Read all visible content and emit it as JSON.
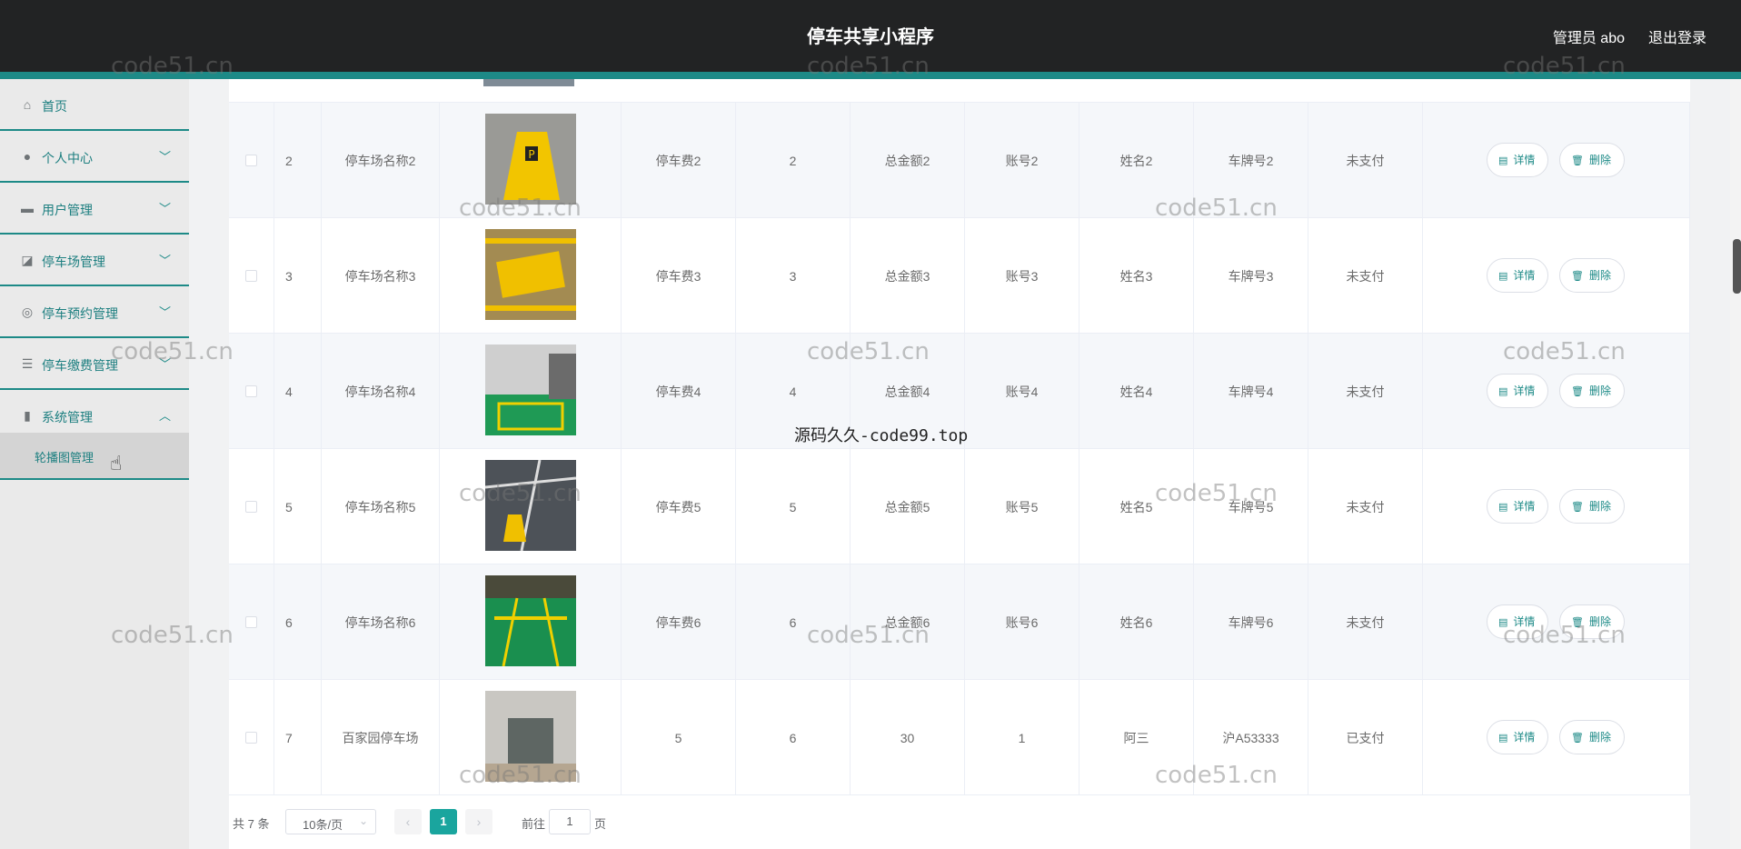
{
  "header": {
    "title": "停车共享小程序",
    "user": "管理员 abo",
    "logout": "退出登录"
  },
  "sidebar": {
    "items": [
      {
        "label": "首页",
        "icon": "home-icon"
      },
      {
        "label": "个人中心",
        "icon": "user-icon",
        "expandable": true
      },
      {
        "label": "用户管理",
        "icon": "users-icon",
        "expandable": true
      },
      {
        "label": "停车场管理",
        "icon": "chart-icon",
        "expandable": true
      },
      {
        "label": "停车预约管理",
        "icon": "lifebuoy-icon",
        "expandable": true
      },
      {
        "label": "停车缴费管理",
        "icon": "list-icon",
        "expandable": true
      },
      {
        "label": "系统管理",
        "icon": "bar-chart-icon",
        "expandable": true,
        "expanded": true
      }
    ],
    "submenu": {
      "label": "轮播图管理"
    }
  },
  "table": {
    "rows": [
      {
        "idx": "2",
        "name": "停车场名称2",
        "fee": "停车费2",
        "hours": "2",
        "total": "总金额2",
        "account": "账号2",
        "person": "姓名2",
        "plate": "车牌号2",
        "status": "未支付",
        "image": "warning-sign"
      },
      {
        "idx": "3",
        "name": "停车场名称3",
        "fee": "停车费3",
        "hours": "3",
        "total": "总金额3",
        "account": "账号3",
        "person": "姓名3",
        "plate": "车牌号3",
        "status": "未支付",
        "image": "reserved-marking"
      },
      {
        "idx": "4",
        "name": "停车场名称4",
        "fee": "停车费4",
        "hours": "4",
        "total": "总金额4",
        "account": "账号4",
        "person": "姓名4",
        "plate": "车牌号4",
        "status": "未支付",
        "image": "garage-space"
      },
      {
        "idx": "5",
        "name": "停车场名称5",
        "fee": "停车费5",
        "hours": "5",
        "total": "总金额5",
        "account": "账号5",
        "person": "姓名5",
        "plate": "车牌号5",
        "status": "未支付",
        "image": "parking-lock"
      },
      {
        "idx": "6",
        "name": "停车场名称6",
        "fee": "停车费6",
        "hours": "6",
        "total": "总金额6",
        "account": "账号6",
        "person": "姓名6",
        "plate": "车牌号6",
        "status": "未支付",
        "image": "green-floor"
      },
      {
        "idx": "7",
        "name": "百家园停车场",
        "fee": "5",
        "hours": "6",
        "total": "30",
        "account": "1",
        "person": "阿三",
        "plate": "沪A53333",
        "status": "已支付",
        "image": "garage-entrance"
      }
    ],
    "detail_label": "详情",
    "delete_label": "删除"
  },
  "pagination": {
    "total": "共 7 条",
    "page_size": "10条/页",
    "current": "1",
    "goto_prefix": "前往",
    "goto_value": "1",
    "goto_suffix": "页",
    "prev": "‹",
    "next": "›"
  },
  "watermarks": {
    "site": "code51.cn",
    "center": "源码久久-code99.top"
  },
  "colors": {
    "accent": "#1d8a87",
    "header_bg": "#222324",
    "active_page": "#1aa59e"
  }
}
